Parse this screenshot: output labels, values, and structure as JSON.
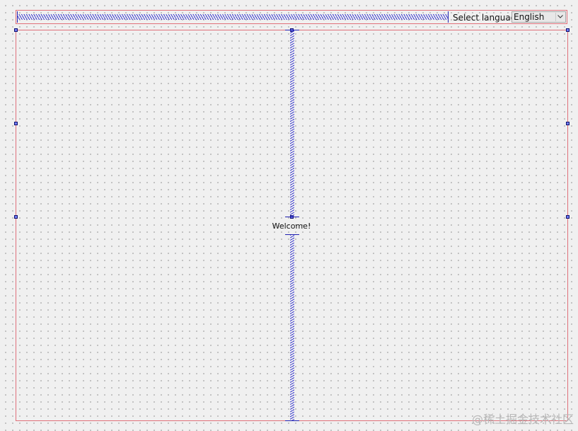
{
  "header": {
    "language_label": "Select language",
    "language_select": {
      "selected": "English"
    }
  },
  "main": {
    "welcome_text": "Welcome!"
  },
  "watermark": "@稀土掘金技术社区",
  "colors": {
    "layout_border": "#e0707a",
    "spacer": "#3a3ad0",
    "handle_fill": "#6f7cf0",
    "grid_dot": "#9a9a9a",
    "background": "#f0f0f0"
  },
  "icons": {
    "combo_arrow": "chevron-down-icon"
  }
}
